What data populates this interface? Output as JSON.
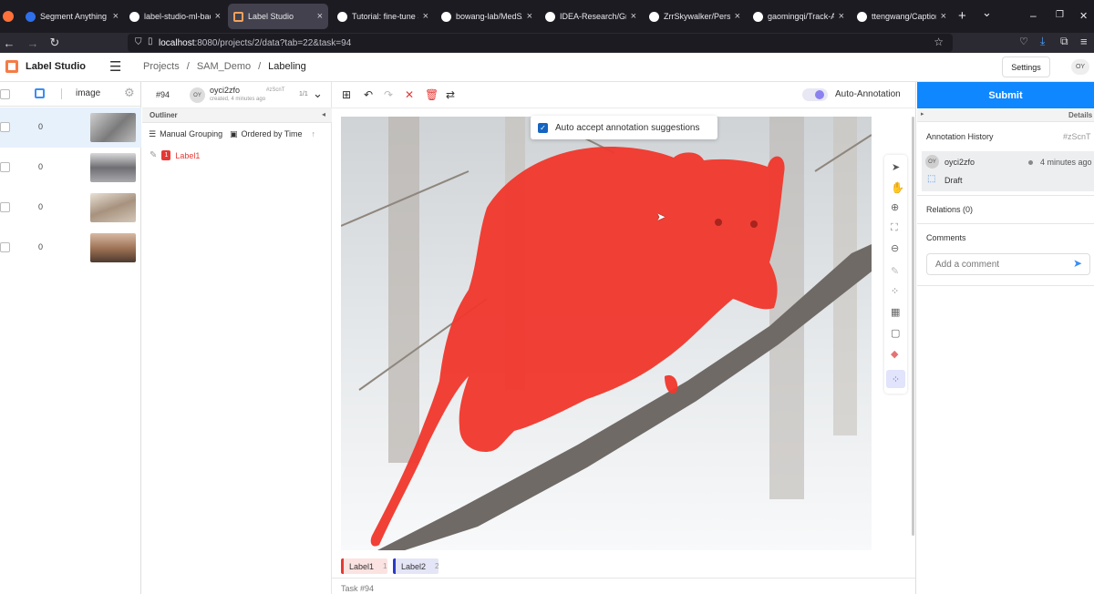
{
  "browser": {
    "tabs": [
      {
        "title": "Segment Anything | M",
        "favicon": "meta-icon"
      },
      {
        "title": "label-studio-ml-backe",
        "favicon": "github-icon"
      },
      {
        "title": "Label Studio",
        "favicon": "label-studio-icon",
        "active": true
      },
      {
        "title": "Tutorial: fine-tune SAM",
        "favicon": "github-icon"
      },
      {
        "title": "bowang-lab/MedSAM",
        "favicon": "github-icon"
      },
      {
        "title": "IDEA-Research/Ground",
        "favicon": "github-icon"
      },
      {
        "title": "ZrrSkywalker/Personali",
        "favicon": "github-icon"
      },
      {
        "title": "gaomingqi/Track-Anyt",
        "favicon": "github-icon"
      },
      {
        "title": "ttengwang/Caption-A",
        "favicon": "github-icon"
      }
    ],
    "url_host": "localhost",
    "url_rest": ":8080/projects/2/data?tab=22&task=94",
    "new_tab": "+",
    "tab_list": "⌄",
    "window": {
      "minimize": "–",
      "restore": "❐",
      "close": "✕"
    }
  },
  "app": {
    "brand": "Label Studio",
    "breadcrumbs": [
      "Projects",
      "SAM_Demo",
      "Labeling"
    ],
    "settings_label": "Settings",
    "avatar_initials": "OY"
  },
  "tasklist": {
    "column": "image",
    "rows": [
      {
        "count": "0",
        "selected": true,
        "thumb_color": "#9a9a9a"
      },
      {
        "count": "0",
        "selected": false,
        "thumb_color": "#7c7c80"
      },
      {
        "count": "0",
        "selected": false,
        "thumb_color": "#b9a99a"
      },
      {
        "count": "0",
        "selected": false,
        "thumb_color": "#8c6d5a"
      }
    ]
  },
  "annotation": {
    "task_number": "#94",
    "user": "oyci2zfo",
    "user_initials": "OY",
    "created": "created, 4 minutes ago",
    "annotation_id": "#zScnT",
    "counter": "1/1",
    "auto_annotation_label": "Auto-Annotation",
    "auto_accept_label": "Auto accept annotation suggestions"
  },
  "outliner": {
    "title": "Outliner",
    "grouping": "Manual Grouping",
    "ordering": "Ordered by Time",
    "regions": [
      {
        "index": "1",
        "label": "Label1",
        "color": "#e53935"
      }
    ]
  },
  "labels": [
    {
      "name": "Label1",
      "hotkey": "1",
      "color": "#e53935",
      "bg": "#fbe3e1"
    },
    {
      "name": "Label2",
      "hotkey": "2",
      "color": "#2c39c7",
      "bg": "#e4e5f6"
    }
  ],
  "footer_task": "Task #94",
  "right_panel": {
    "submit_label": "Submit",
    "details_label": "Details",
    "history_title": "Annotation History",
    "history_id": "#zScnT",
    "history_user": "oyci2zfo",
    "history_user_initials": "OY",
    "history_time": "4 minutes ago",
    "history_status": "Draft",
    "relations_label": "Relations (0)",
    "comments_title": "Comments",
    "comment_placeholder": "Add a comment"
  },
  "colors": {
    "accent": "#0f87ff",
    "mask": "#f0382e",
    "brand": "#f57b46"
  }
}
